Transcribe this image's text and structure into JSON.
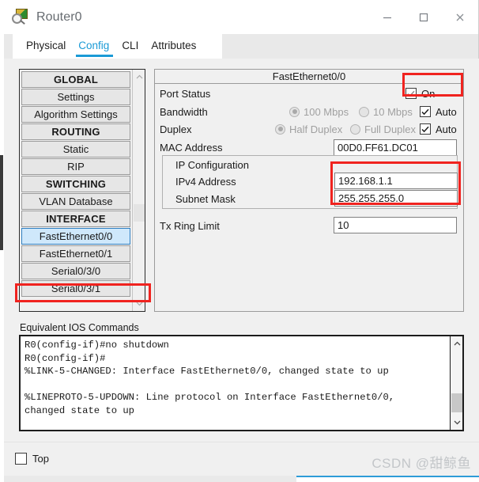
{
  "window": {
    "title": "Router0",
    "icon": "packet-tracer-icon",
    "minimize_label": "—",
    "maximize_label": "□",
    "close_label": "✕"
  },
  "tabs": [
    {
      "label": "Physical",
      "active": false
    },
    {
      "label": "Config",
      "active": true
    },
    {
      "label": "CLI",
      "active": false
    },
    {
      "label": "Attributes",
      "active": false
    }
  ],
  "sidebar": {
    "items": [
      {
        "label": "GLOBAL",
        "type": "header"
      },
      {
        "label": "Settings",
        "type": "item"
      },
      {
        "label": "Algorithm Settings",
        "type": "item"
      },
      {
        "label": "ROUTING",
        "type": "header"
      },
      {
        "label": "Static",
        "type": "item"
      },
      {
        "label": "RIP",
        "type": "item"
      },
      {
        "label": "SWITCHING",
        "type": "header"
      },
      {
        "label": "VLAN Database",
        "type": "item"
      },
      {
        "label": "INTERFACE",
        "type": "header"
      },
      {
        "label": "FastEthernet0/0",
        "type": "item",
        "selected": true
      },
      {
        "label": "FastEthernet0/1",
        "type": "item"
      },
      {
        "label": "Serial0/3/0",
        "type": "item"
      },
      {
        "label": "Serial0/3/1",
        "type": "item"
      }
    ]
  },
  "config": {
    "panel_title": "FastEthernet0/0",
    "port_status": {
      "label": "Port Status",
      "checkbox_label": "On",
      "checked": true
    },
    "bandwidth": {
      "label": "Bandwidth",
      "option_100": "100 Mbps",
      "option_10": "10 Mbps",
      "auto_label": "Auto",
      "auto_checked": true,
      "selected": "100 Mbps"
    },
    "duplex": {
      "label": "Duplex",
      "option_half": "Half Duplex",
      "option_full": "Full Duplex",
      "auto_label": "Auto",
      "auto_checked": true,
      "selected": "Half Duplex"
    },
    "mac_address": {
      "label": "MAC Address",
      "value": "00D0.FF61.DC01"
    },
    "ip_configuration": {
      "group_label": "IP Configuration",
      "ipv4_label": "IPv4 Address",
      "ipv4_value": "192.168.1.1",
      "subnet_label": "Subnet Mask",
      "subnet_value": "255.255.255.0"
    },
    "tx_ring_limit": {
      "label": "Tx Ring Limit",
      "value": "10"
    }
  },
  "ios": {
    "label": "Equivalent IOS Commands",
    "text": "R0(config-if)#no shutdown\nR0(config-if)#\n%LINK-5-CHANGED: Interface FastEthernet0/0, changed state to up\n\n%LINEPROTO-5-UPDOWN: Line protocol on Interface FastEthernet0/0,\nchanged state to up"
  },
  "bottom": {
    "top_label": "Top",
    "top_checked": false,
    "watermark": "CSDN @甜鲸鱼"
  },
  "colors": {
    "accent": "#1a9ad6",
    "annotation": "#f0231f",
    "selection": "#cfe8fb",
    "panel": "#f0f0f0"
  }
}
